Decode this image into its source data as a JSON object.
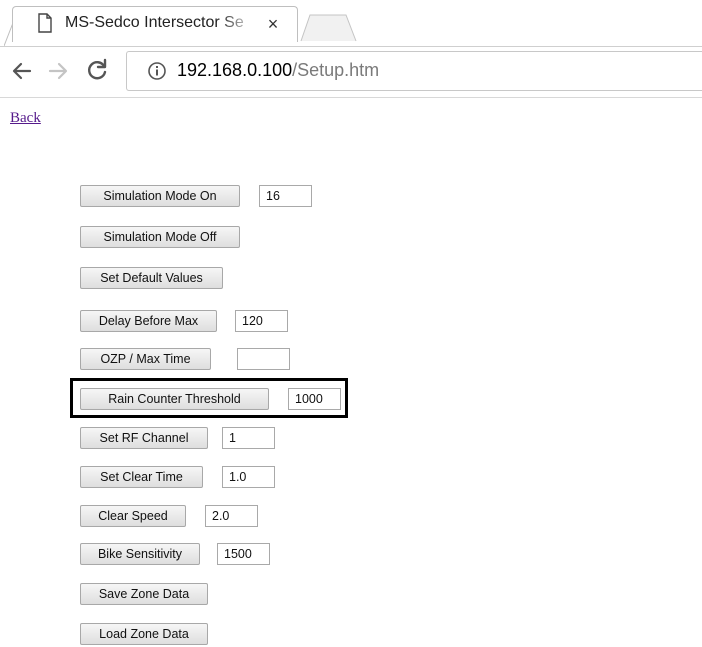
{
  "browser": {
    "tab_title": "MS-Sedco Intersector Se",
    "tab_close": "×",
    "url_host": "192.168.0.100",
    "url_path": "/Setup.htm"
  },
  "page": {
    "back_link": "Back"
  },
  "controls": [
    {
      "button": "Simulation Mode On",
      "value": "16"
    },
    {
      "button": "Simulation Mode Off"
    },
    {
      "button": "Set Default Values"
    },
    {
      "button": "Delay Before Max",
      "value": "120"
    },
    {
      "button": "OZP / Max Time",
      "value": ""
    },
    {
      "button": "Rain Counter Threshold",
      "value": "1000",
      "highlighted": true
    },
    {
      "button": "Set RF Channel",
      "value": "1"
    },
    {
      "button": "Set Clear Time",
      "value": "1.0"
    },
    {
      "button": "Clear Speed",
      "value": "2.0"
    },
    {
      "button": "Bike Sensitivity",
      "value": "1500"
    },
    {
      "button": "Save Zone Data"
    },
    {
      "button": "Load Zone Data"
    }
  ],
  "colors": {
    "link": "#551a8b",
    "highlight_border": "#000000",
    "button_border": "#a8a8a8"
  }
}
